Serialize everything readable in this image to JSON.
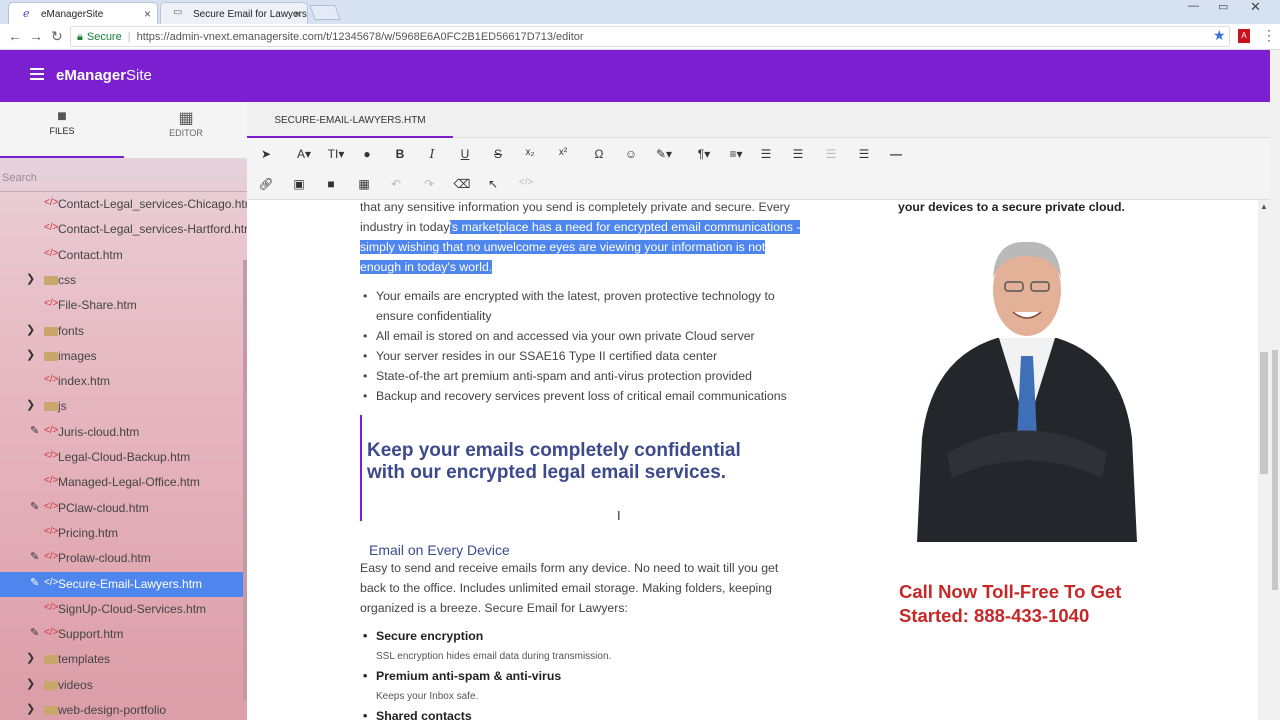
{
  "browser": {
    "tabs": [
      {
        "label": "eManagerSite",
        "favicon": "e",
        "close": "×"
      },
      {
        "label": "Secure Email for Lawyers",
        "favicon": "doc-icon",
        "close": "×"
      }
    ],
    "secure_label": "Secure",
    "url": "https://admin-vnext.emanagersite.com/t/12345678/w/5968E6A0FC2B1ED56617D713/editor"
  },
  "app": {
    "brand_bold": "eManager",
    "brand_rest": "Site"
  },
  "sidebar": {
    "tabs": [
      {
        "label": "FILES"
      },
      {
        "label": "EDITOR"
      }
    ],
    "search_placeholder": "Search",
    "files": [
      {
        "name": "Contact-Legal_services-Chicago.htm",
        "type": "file"
      },
      {
        "name": "Contact-Legal_services-Hartford.htm",
        "type": "file"
      },
      {
        "name": "Contact.htm",
        "type": "file"
      },
      {
        "name": "css",
        "type": "folder"
      },
      {
        "name": "File-Share.htm",
        "type": "file"
      },
      {
        "name": "fonts",
        "type": "folder"
      },
      {
        "name": "images",
        "type": "folder"
      },
      {
        "name": "index.htm",
        "type": "file"
      },
      {
        "name": "js",
        "type": "folder"
      },
      {
        "name": "Juris-cloud.htm",
        "type": "file",
        "edited": true
      },
      {
        "name": "Legal-Cloud-Backup.htm",
        "type": "file"
      },
      {
        "name": "Managed-Legal-Office.htm",
        "type": "file"
      },
      {
        "name": "PClaw-cloud.htm",
        "type": "file",
        "edited": true
      },
      {
        "name": "Pricing.htm",
        "type": "file"
      },
      {
        "name": "Prolaw-cloud.htm",
        "type": "file",
        "edited": true
      },
      {
        "name": "Secure-Email-Lawyers.htm",
        "type": "file",
        "edited": true,
        "selected": true
      },
      {
        "name": "SignUp-Cloud-Services.htm",
        "type": "file"
      },
      {
        "name": "Support.htm",
        "type": "file",
        "edited": true
      },
      {
        "name": "templates",
        "type": "folder"
      },
      {
        "name": "videos",
        "type": "folder"
      },
      {
        "name": "web-design-portfolio",
        "type": "folder"
      }
    ]
  },
  "editor": {
    "file_tab": "SECURE-EMAIL-LAWYERS.HTM"
  },
  "doc": {
    "intro_line1": "that any sensitive information you send is completely private and secure. Every",
    "intro_line2_plain": "industry in today",
    "intro_line2_hl": "'s marketplace has a need for encrypted email communications -",
    "intro_line3_hl": "simply wishing that no unwelcome eyes are viewing your information is not",
    "intro_line4_hl": "enough in today's world.",
    "bullets": [
      "Your emails are encrypted with the latest, proven protective technology to",
      "ensure confidentiality",
      "All email is stored on and accessed via your own private Cloud server",
      "Your server resides in our SSAE16 Type II certified data center",
      "State-of-the art premium anti-spam and anti-virus protection provided",
      "Backup and recovery services prevent loss of critical email communications"
    ],
    "headline1": "Keep your emails completely confidential",
    "headline2": "with our encrypted legal email services.",
    "subhead": "Email on Every Device",
    "para": [
      "Easy to send and receive emails form any device. No need to wait till you get",
      "back to the office. Includes unlimited email storage. Making folders, keeping",
      "organized is a breeze. Secure Email for Lawyers:"
    ],
    "features": [
      {
        "title": "Secure encryption",
        "desc": "SSL encryption hides email data during transmission."
      },
      {
        "title": "Premium anti-spam & anti-virus",
        "desc": "Keeps your Inbox safe."
      },
      {
        "title": "Shared contacts",
        "desc": ""
      }
    ],
    "right_text": "your devices to a secure private cloud.",
    "call1": "Call Now Toll-Free To Get",
    "call2": "Started: 888-433-1040"
  }
}
